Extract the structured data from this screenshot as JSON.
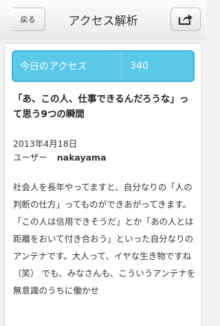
{
  "navbar": {
    "back_label": "戻る",
    "title": "アクセス解析",
    "share_icon": "share-icon"
  },
  "access": {
    "label": "今日のアクセス",
    "count": "340"
  },
  "article": {
    "title": "「あ、この人、仕事できるんだろうな」って思う9つの瞬間",
    "date": "2013年4月18日",
    "user_label": "ユーザー",
    "user_name": "nakayama",
    "body": "社会人を長年やってますと、自分なりの「人の判断の仕方」ってものができあがってきます。「この人は信用できそうだ」とか「あの人とは距離をおいて付き合おう」といった自分なりのアンテナです。大人って、イヤな生き物ですね（笑） でも、みなさんも、こういうアンテナを無意識のうちに働かせ"
  },
  "colors": {
    "accent": "#5ac8e8",
    "accent_border": "#3eaed6"
  }
}
